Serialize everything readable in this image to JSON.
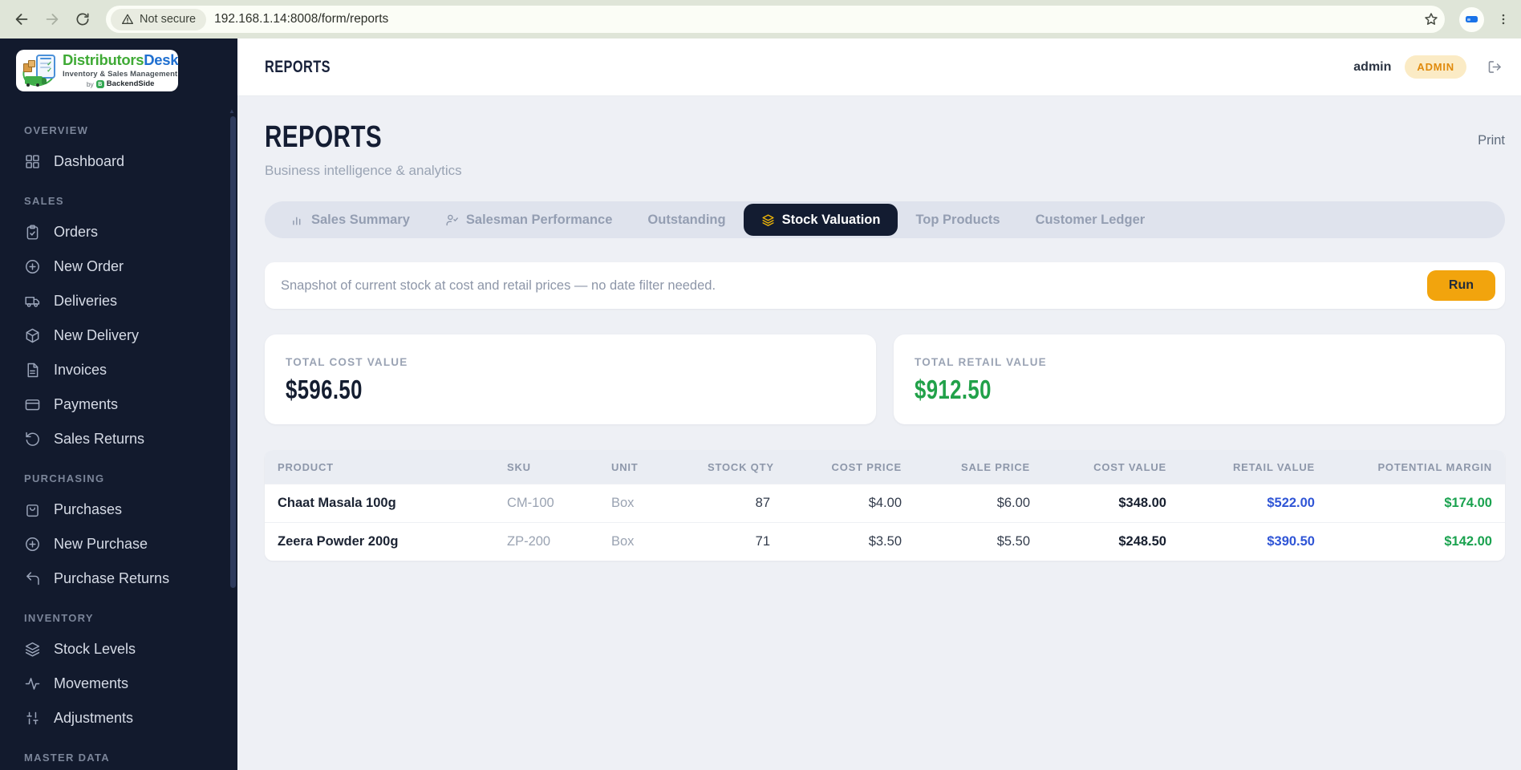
{
  "browser": {
    "security_label": "Not secure",
    "url": "192.168.1.14:8008/form/reports"
  },
  "logo": {
    "brand_primary": "Distributors",
    "brand_secondary": "Desk",
    "tagline": "Inventory & Sales Management",
    "byline": "by",
    "byline_brand": "BackendSide",
    "byline_mark": "B"
  },
  "sidebar": {
    "sections": [
      {
        "label": "OVERVIEW",
        "items": [
          {
            "label": "Dashboard",
            "icon": "grid-icon"
          }
        ]
      },
      {
        "label": "SALES",
        "items": [
          {
            "label": "Orders",
            "icon": "clipboard-check-icon"
          },
          {
            "label": "New Order",
            "icon": "plus-circle-icon"
          },
          {
            "label": "Deliveries",
            "icon": "truck-icon"
          },
          {
            "label": "New Delivery",
            "icon": "package-icon"
          },
          {
            "label": "Invoices",
            "icon": "file-text-icon"
          },
          {
            "label": "Payments",
            "icon": "credit-card-icon"
          },
          {
            "label": "Sales Returns",
            "icon": "rotate-ccw-icon"
          }
        ]
      },
      {
        "label": "PURCHASING",
        "items": [
          {
            "label": "Purchases",
            "icon": "shopping-bag-icon"
          },
          {
            "label": "New Purchase",
            "icon": "plus-circle-icon"
          },
          {
            "label": "Purchase Returns",
            "icon": "corner-up-left-icon"
          }
        ]
      },
      {
        "label": "INVENTORY",
        "items": [
          {
            "label": "Stock Levels",
            "icon": "layers-icon"
          },
          {
            "label": "Movements",
            "icon": "activity-icon"
          },
          {
            "label": "Adjustments",
            "icon": "sliders-icon"
          }
        ]
      },
      {
        "label": "MASTER DATA",
        "items": []
      }
    ]
  },
  "header": {
    "title": "REPORTS",
    "username": "admin",
    "role_badge": "ADMIN"
  },
  "page": {
    "title": "REPORTS",
    "subtitle": "Business intelligence & analytics",
    "print_label": "Print"
  },
  "tabs": [
    {
      "label": "Sales Summary",
      "icon": "bar-chart-icon",
      "active": false
    },
    {
      "label": "Salesman Performance",
      "icon": "user-check-icon",
      "active": false
    },
    {
      "label": "Outstanding",
      "active": false
    },
    {
      "label": "Stock Valuation",
      "icon": "layers-icon",
      "active": true
    },
    {
      "label": "Top Products",
      "active": false
    },
    {
      "label": "Customer Ledger",
      "active": false
    }
  ],
  "report": {
    "banner": "Snapshot of current stock at cost and retail prices — no date filter needed.",
    "run_label": "Run"
  },
  "summary_cards": [
    {
      "label": "TOTAL COST VALUE",
      "value": "$596.50"
    },
    {
      "label": "TOTAL RETAIL VALUE",
      "value": "$912.50"
    }
  ],
  "table": {
    "columns": [
      "PRODUCT",
      "SKU",
      "UNIT",
      "STOCK QTY",
      "COST PRICE",
      "SALE PRICE",
      "COST VALUE",
      "RETAIL VALUE",
      "POTENTIAL MARGIN"
    ],
    "rows": [
      {
        "product": "Chaat Masala 100g",
        "sku": "CM-100",
        "unit": "Box",
        "stock_qty": "87",
        "cost_price": "$4.00",
        "sale_price": "$6.00",
        "cost_value": "$348.00",
        "retail_value": "$522.00",
        "potential_margin": "$174.00"
      },
      {
        "product": "Zeera Powder 200g",
        "sku": "ZP-200",
        "unit": "Box",
        "stock_qty": "71",
        "cost_price": "$3.50",
        "sale_price": "$5.50",
        "cost_value": "$248.50",
        "retail_value": "$390.50",
        "potential_margin": "$142.00"
      }
    ]
  },
  "colors": {
    "accent_amber": "#F2A40D",
    "active_tab_bg": "#131C31",
    "sidebar_bg": "#121A2D",
    "positive_green": "#1AA24F",
    "retail_blue": "#2F55D6",
    "badge_bg": "#FBEBC5",
    "badge_text": "#E08A0C"
  }
}
